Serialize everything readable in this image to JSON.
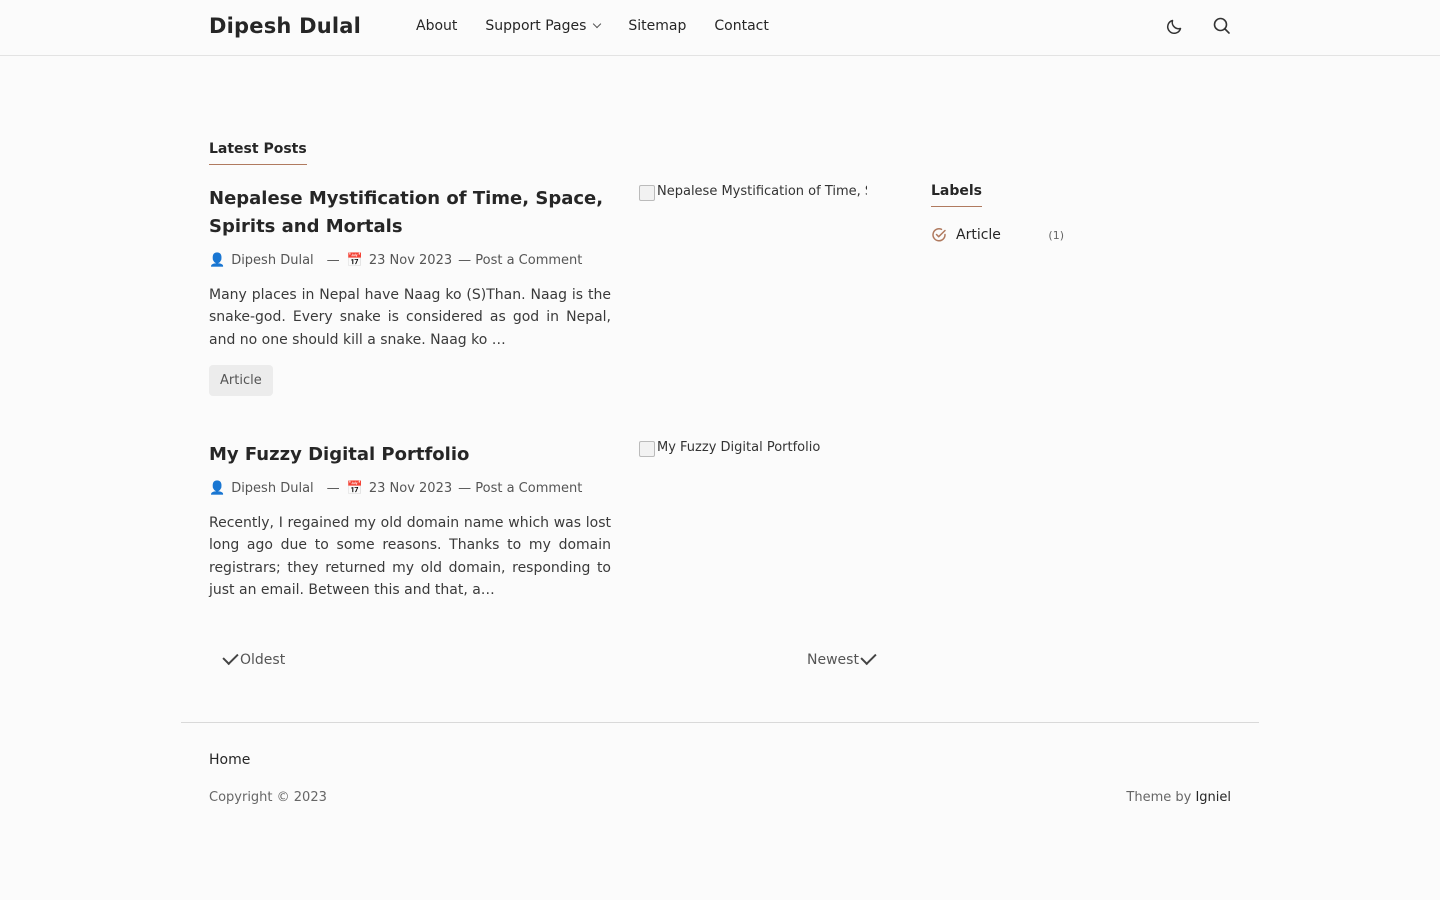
{
  "header": {
    "site_title": "Dipesh Dulal",
    "nav": [
      {
        "label": "About"
      },
      {
        "label": "Support Pages"
      },
      {
        "label": "Sitemap"
      },
      {
        "label": "Contact"
      }
    ],
    "icons": [
      "moon-icon",
      "search-icon"
    ]
  },
  "main": {
    "section_title": "Latest Posts",
    "posts": [
      {
        "title": "Nepalese Mystification of Time, Space, Spirits and Mortals",
        "author": "Dipesh Dulal",
        "date": "23 Nov 2023",
        "comment_label": "— Post a Comment",
        "snippet": "Many places in Nepal have Naag ko (S)Than. Naag is the snake-god. Every snake is considered as god in Nepal, and no one should kill a snake. Naag ko …",
        "tag": "Article",
        "image_alt": "Nepalese Mystification of Time, Space, Spirits and Mortals"
      },
      {
        "title": "My Fuzzy Digital Portfolio",
        "author": "Dipesh Dulal",
        "date": "23 Nov 2023",
        "comment_label": "— Post a Comment",
        "snippet": "Recently, I regained my old domain name which was lost long ago due to some reasons. Thanks to my domain registrars; they returned my old domain, responding to just an email. Between this and that, a…",
        "image_alt": "My Fuzzy Digital Portfolio"
      }
    ],
    "pager": {
      "older": "Oldest",
      "newer": "Newest"
    }
  },
  "sidebar": {
    "labels_title": "Labels",
    "labels": [
      {
        "name": "Article",
        "count": "(1)"
      }
    ]
  },
  "footer": {
    "home": "Home",
    "copyright": "Copyright © 2023",
    "theme_prefix": "Theme by",
    "theme_author": "Igniel"
  },
  "colors": {
    "accent": "#b07a5f",
    "background": "#fbfbfb"
  }
}
